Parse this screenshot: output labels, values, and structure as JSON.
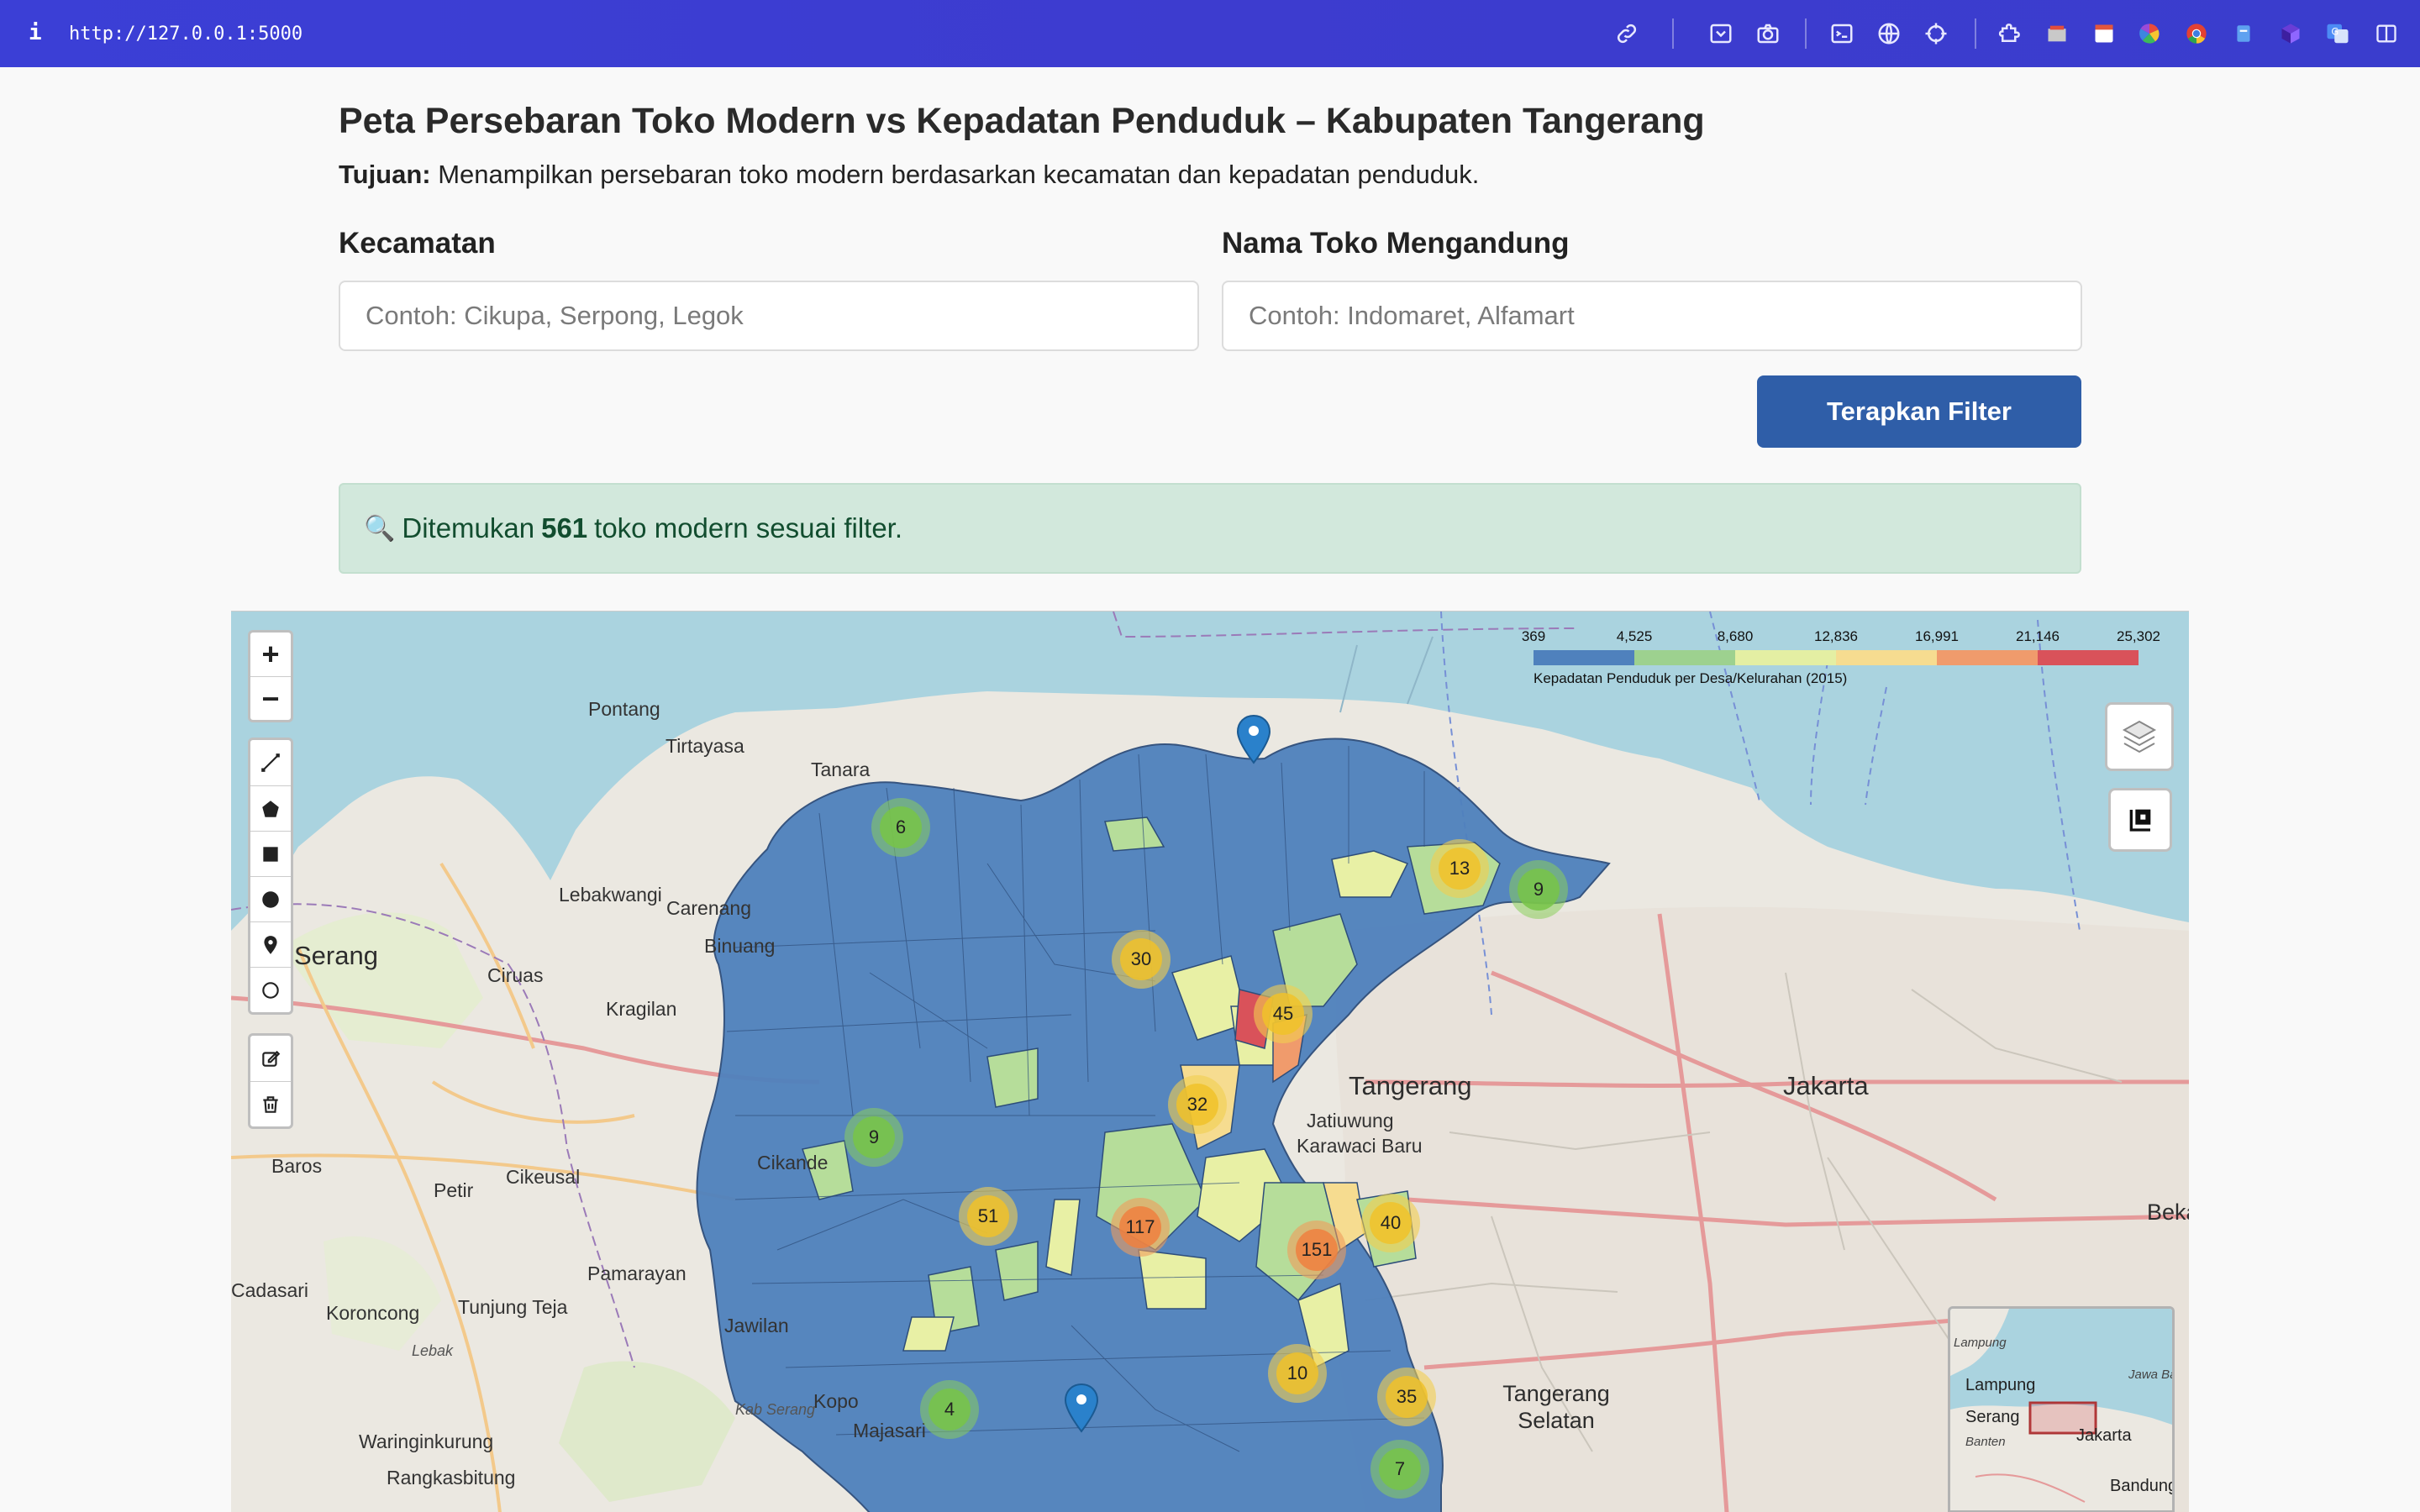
{
  "browser": {
    "info_label": "i",
    "url": "http://127.0.0.1:5000"
  },
  "page": {
    "title": "Peta Persebaran Toko Modern vs Kepadatan Penduduk – Kabupaten Tangerang",
    "purpose_label": "Tujuan:",
    "purpose_text": " Menampilkan persebaran toko modern berdasarkan kecamatan dan kepadatan penduduk."
  },
  "filters": {
    "kecamatan_label": "Kecamatan",
    "kecamatan_placeholder": "Contoh: Cikupa, Serpong, Legok",
    "kecamatan_value": "",
    "toko_label": "Nama Toko Mengandung",
    "toko_placeholder": "Contoh: Indomaret, Alfamart",
    "toko_value": "",
    "apply_label": "Terapkan Filter"
  },
  "result": {
    "icon": "🔍",
    "prefix": "Ditemukan",
    "count": "561",
    "suffix": "toko modern sesuai filter."
  },
  "map": {
    "zoom_in": "+",
    "zoom_out": "−",
    "legend": {
      "ticks": [
        "369",
        "4,525",
        "8,680",
        "12,836",
        "16,991",
        "21,146",
        "25,302"
      ],
      "colors": [
        "#4f81bd",
        "#4f81bd",
        "#9dd18f",
        "#e4efa3",
        "#f6dc90",
        "#f09b6c",
        "#d9525a"
      ],
      "caption": "Kepadatan Penduduk per Desa/Kelurahan (2015)"
    },
    "place_labels": [
      "Pontang",
      "Tirtayasa",
      "Tanara",
      "Lebakwangi",
      "Carenang",
      "Binuang",
      "Serang",
      "Ciruas",
      "Kragilan",
      "Baros",
      "Petir",
      "Cikeusal",
      "Cikande",
      "Cadasari",
      "Koroncong",
      "Tunjung Teja",
      "Pamarayan",
      "Jawilan",
      "Kopo",
      "Majasari",
      "Waringinkurung",
      "Rangkasbitung",
      "Lebak",
      "Kab Serang",
      "Tangerang",
      "Jakarta",
      "Jatiuwung",
      "Karawaci Baru",
      "Tangerang Selatan",
      "Bekasi"
    ],
    "clusters": [
      {
        "count": "6",
        "size": "small"
      },
      {
        "count": "13",
        "size": "med"
      },
      {
        "count": "9",
        "size": "small"
      },
      {
        "count": "30",
        "size": "med"
      },
      {
        "count": "45",
        "size": "med"
      },
      {
        "count": "32",
        "size": "med"
      },
      {
        "count": "9",
        "size": "small"
      },
      {
        "count": "51",
        "size": "med"
      },
      {
        "count": "117",
        "size": "large"
      },
      {
        "count": "151",
        "size": "large"
      },
      {
        "count": "40",
        "size": "med"
      },
      {
        "count": "10",
        "size": "med"
      },
      {
        "count": "35",
        "size": "med"
      },
      {
        "count": "4",
        "size": "small"
      },
      {
        "count": "7",
        "size": "small"
      }
    ],
    "minimap_labels": [
      "Lampung",
      "Serang",
      "Jakarta",
      "Banten",
      "Bandung",
      "Jawa Barat"
    ]
  }
}
